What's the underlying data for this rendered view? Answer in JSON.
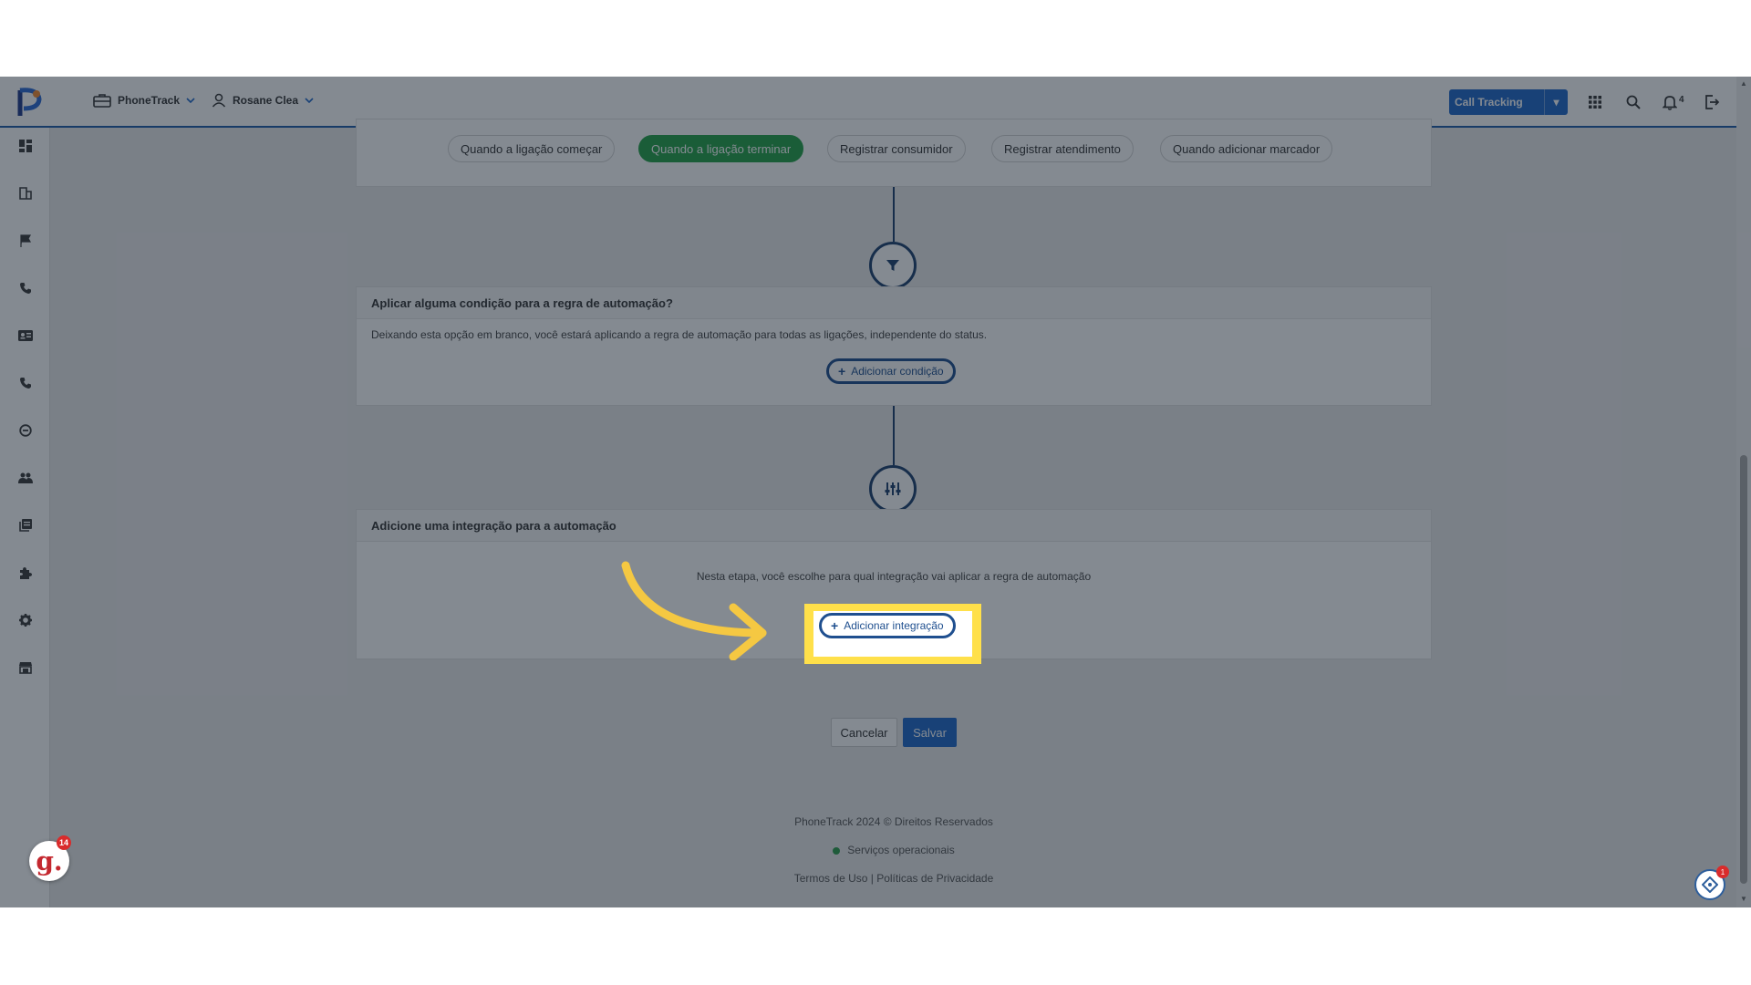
{
  "topbar": {
    "account_menu": "PhoneTrack",
    "user_menu": "Rosane Clea",
    "product_button": "Call Tracking",
    "notification_count": "4"
  },
  "sidebar": {
    "icons": [
      "dashboard-icon",
      "building-icon",
      "flag-icon",
      "phone-icon",
      "contact-card-icon",
      "phone-icon",
      "block-icon",
      "users-icon",
      "reports-icon",
      "puzzle-icon",
      "gear-icon",
      "store-icon"
    ]
  },
  "triggers": {
    "tabs": [
      {
        "label": "Quando a ligação começar",
        "active": false
      },
      {
        "label": "Quando a ligação terminar",
        "active": true
      },
      {
        "label": "Registrar consumidor",
        "active": false
      },
      {
        "label": "Registrar atendimento",
        "active": false
      },
      {
        "label": "Quando adicionar marcador",
        "active": false
      }
    ]
  },
  "condition_card": {
    "title": "Aplicar alguma condição para a regra de automação?",
    "description": "Deixando esta opção em branco, você estará aplicando a regra de automação para todas as ligações, independente do status.",
    "add_button": "Adicionar condição"
  },
  "integration_card": {
    "title": "Adicione uma integração para a automação",
    "description": "Nesta etapa, você escolhe para qual integração vai aplicar a regra de automação",
    "add_button": "Adicionar integração"
  },
  "actions": {
    "cancel": "Cancelar",
    "save": "Salvar"
  },
  "footer": {
    "copyright": "PhoneTrack 2024 © Direitos Reservados",
    "status": "Serviços operacionais",
    "links": "Termos de Uso | Políticas de Privacidade"
  },
  "widgets": {
    "g_letter": "g.",
    "g_badge": "14",
    "chat_badge": "1"
  },
  "colors": {
    "primary_blue": "#1e66c9",
    "active_green": "#22a246",
    "highlight_yellow": "#ffe04a",
    "arrow_yellow": "#f5c842"
  }
}
